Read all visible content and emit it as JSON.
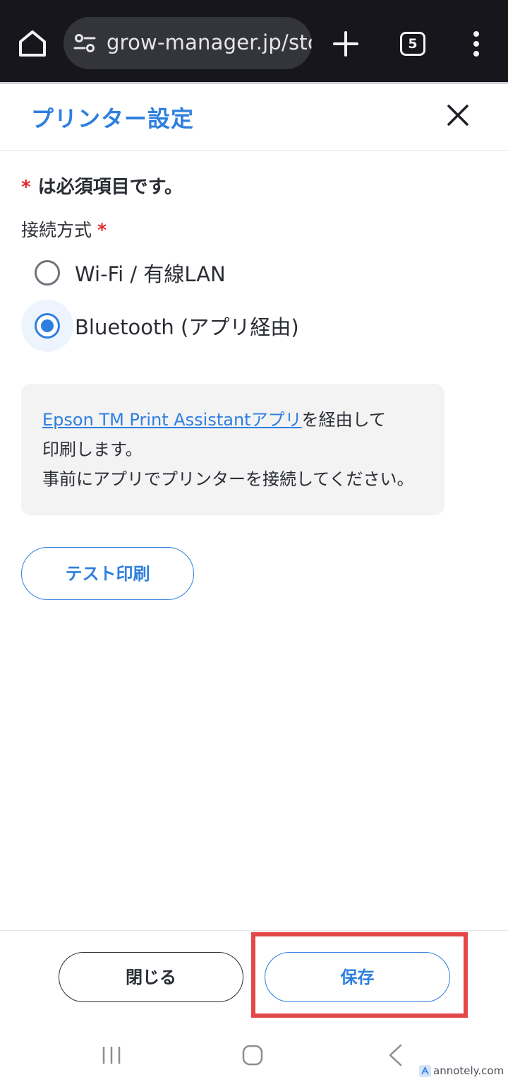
{
  "browser": {
    "url": "grow-manager.jp/stc",
    "tab_count": "5"
  },
  "dialog": {
    "title": "プリンター設定",
    "required_star": "*",
    "required_note": "は必須項目です。",
    "connection_label": "接続方式",
    "connection_star": "*",
    "options": [
      {
        "label": "Wi-Fi / 有線LAN",
        "selected": false
      },
      {
        "label": "Bluetooth (アプリ経由)",
        "selected": true
      }
    ],
    "info": {
      "link_text": "Epson TM Print Assistantアプリ",
      "text_after_link": "を経由して",
      "line2": "印刷します。",
      "line3": "事前にアプリでプリンターを接続してください。"
    },
    "test_print_label": "テスト印刷",
    "close_label": "閉じる",
    "save_label": "保存"
  },
  "colors": {
    "accent": "#2e7fdf",
    "required": "#e02a2a",
    "highlight": "#e34747"
  },
  "watermark": "annotely.com"
}
